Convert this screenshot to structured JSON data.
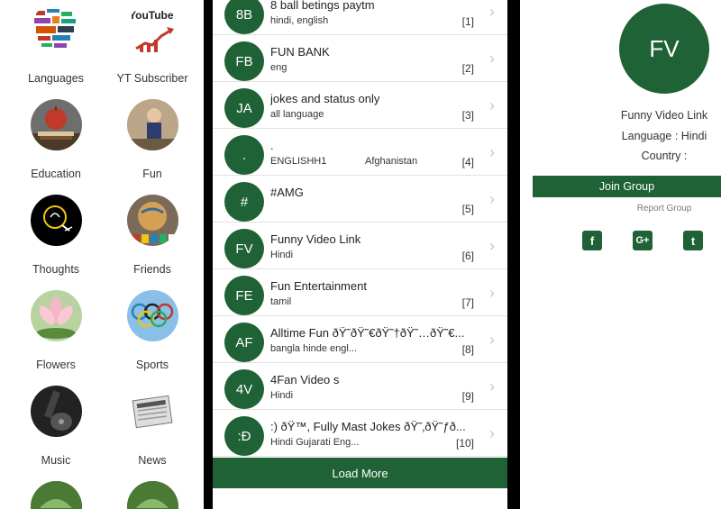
{
  "categories": [
    {
      "label": "Languages",
      "icon": "languages-icon"
    },
    {
      "label": "YT Subscriber",
      "icon": "youtube-icon"
    },
    {
      "label": "Education",
      "icon": "education-icon"
    },
    {
      "label": "Fun",
      "icon": "fun-icon"
    },
    {
      "label": "Thoughts",
      "icon": "thoughts-icon"
    },
    {
      "label": "Friends",
      "icon": "friends-icon"
    },
    {
      "label": "Flowers",
      "icon": "flower-icon"
    },
    {
      "label": "Sports",
      "icon": "sports-icon"
    },
    {
      "label": "Music",
      "icon": "music-icon"
    },
    {
      "label": "News",
      "icon": "news-icon"
    },
    {
      "label": "",
      "icon": "nature-icon"
    },
    {
      "label": "",
      "icon": "nature-icon"
    }
  ],
  "youtube_logo_text": "YouTube",
  "groups": [
    {
      "initials": "8B",
      "name": "8 ball betings paytm",
      "lang": "hindi, english",
      "country": "",
      "index": "[1]"
    },
    {
      "initials": "FB",
      "name": "FUN BANK",
      "lang": "eng",
      "country": "",
      "index": "[2]"
    },
    {
      "initials": "JA",
      "name": "jokes and status only",
      "lang": "all language",
      "country": "",
      "index": "[3]"
    },
    {
      "initials": ".",
      "name": ".",
      "lang": "ENGLISHH1",
      "country": "Afghanistan",
      "index": "[4]"
    },
    {
      "initials": "#",
      "name": "#AMG",
      "lang": "",
      "country": "",
      "index": "[5]"
    },
    {
      "initials": "FV",
      "name": "Funny Video Link",
      "lang": "Hindi",
      "country": "",
      "index": "[6]"
    },
    {
      "initials": "FE",
      "name": "Fun Entertainment",
      "lang": "tamil",
      "country": "",
      "index": "[7]"
    },
    {
      "initials": "AF",
      "name": "Alltime Fun ðŸ˜ðŸ˜€ðŸ˜†ðŸ˜…ðŸ˜€...",
      "lang": "bangla hinde engl...",
      "country": "",
      "index": "[8]"
    },
    {
      "initials": "4V",
      "name": "4Fan Video s",
      "lang": "Hindi",
      "country": "",
      "index": "[9]"
    },
    {
      "initials": ":Ð",
      "name": ":) ðŸ™, Fully Mast Jokes ðŸ˜‚ðŸ˜ƒð...",
      "lang": "Hindi Gujarati Eng...",
      "country": "",
      "index": "[10]"
    }
  ],
  "load_more": "Load More",
  "detail": {
    "initials": "FV",
    "name": "Funny Video Link",
    "language": "Language : Hindi",
    "country": "Country :",
    "join": "Join Group",
    "report": "Report Group",
    "social": [
      {
        "icon": "facebook-icon",
        "glyph": "f"
      },
      {
        "icon": "google-plus-icon",
        "glyph": "G+"
      },
      {
        "icon": "twitter-icon",
        "glyph": "t"
      }
    ]
  },
  "colors": {
    "accent": "#1e6235"
  }
}
